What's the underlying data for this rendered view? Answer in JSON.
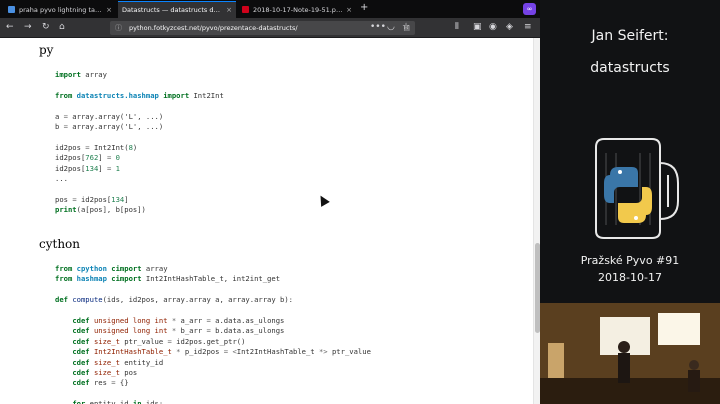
{
  "tabs": [
    {
      "title": "praha pyvo lightning talks (bit…",
      "favicon_color": "#4a90e2",
      "active": false
    },
    {
      "title": "Datastructs — datastructs docume…",
      "favicon_color": "",
      "active": true
    },
    {
      "title": "2018-10-17-Note-19-51.pdf – C…",
      "favicon_color": "#d0021b",
      "favicon_text": "PDF",
      "active": false
    }
  ],
  "navbar": {
    "url": "python.fotkyzcest.net/pyvo/prezentace-datastructs/"
  },
  "sections": [
    {
      "heading": "py",
      "lines": [
        [
          [
            "kw",
            "import"
          ],
          [
            "t",
            " array"
          ]
        ],
        [],
        [
          [
            "kw",
            "from"
          ],
          [
            "t",
            " "
          ],
          [
            "mod",
            "datastructs.hashmap"
          ],
          [
            "t",
            " "
          ],
          [
            "kw",
            "import"
          ],
          [
            "t",
            " Int2Int"
          ]
        ],
        [],
        [
          [
            "t",
            "a "
          ],
          [
            "op",
            "="
          ],
          [
            "t",
            " array.array('L', ...)"
          ]
        ],
        [
          [
            "t",
            "b "
          ],
          [
            "op",
            "="
          ],
          [
            "t",
            " array.array('L', ...)"
          ]
        ],
        [],
        [
          [
            "t",
            "id2pos "
          ],
          [
            "op",
            "="
          ],
          [
            "t",
            " Int2Int("
          ],
          [
            "num",
            "8"
          ],
          [
            "t",
            ")"
          ]
        ],
        [
          [
            "t",
            "id2pos["
          ],
          [
            "num",
            "762"
          ],
          [
            "t",
            "] "
          ],
          [
            "op",
            "="
          ],
          [
            "t",
            " "
          ],
          [
            "num",
            "0"
          ]
        ],
        [
          [
            "t",
            "id2pos["
          ],
          [
            "num",
            "134"
          ],
          [
            "t",
            "] "
          ],
          [
            "op",
            "="
          ],
          [
            "t",
            " "
          ],
          [
            "num",
            "1"
          ]
        ],
        [
          [
            "t",
            "..."
          ]
        ],
        [],
        [
          [
            "t",
            "pos "
          ],
          [
            "op",
            "="
          ],
          [
            "t",
            " id2pos["
          ],
          [
            "num",
            "134"
          ],
          [
            "t",
            "]"
          ]
        ],
        [
          [
            "kw",
            "print"
          ],
          [
            "t",
            "(a[pos], b[pos])"
          ]
        ]
      ]
    },
    {
      "heading": "cython",
      "lines": [
        [
          [
            "kw",
            "from"
          ],
          [
            "t",
            " "
          ],
          [
            "mod",
            "cpython"
          ],
          [
            "t",
            " "
          ],
          [
            "kw",
            "cimport"
          ],
          [
            "t",
            " array"
          ]
        ],
        [
          [
            "kw",
            "from"
          ],
          [
            "t",
            " "
          ],
          [
            "mod",
            "hashmap"
          ],
          [
            "t",
            " "
          ],
          [
            "kw",
            "cimport"
          ],
          [
            "t",
            " Int2IntHashTable_t, int2int_get"
          ]
        ],
        [],
        [
          [
            "kw",
            "def"
          ],
          [
            "t",
            " "
          ],
          [
            "fn",
            "compute"
          ],
          [
            "t",
            "(ids, id2pos, array.array a, array.array b):"
          ]
        ],
        [],
        [
          [
            "t",
            "    "
          ],
          [
            "kw",
            "cdef"
          ],
          [
            "t",
            " "
          ],
          [
            "ty",
            "unsigned"
          ],
          [
            "t",
            " "
          ],
          [
            "ty",
            "long"
          ],
          [
            "t",
            " "
          ],
          [
            "ty",
            "int"
          ],
          [
            "t",
            " "
          ],
          [
            "op",
            "*"
          ],
          [
            "t",
            " a_arr "
          ],
          [
            "op",
            "="
          ],
          [
            "t",
            " a.data.as_ulongs"
          ]
        ],
        [
          [
            "t",
            "    "
          ],
          [
            "kw",
            "cdef"
          ],
          [
            "t",
            " "
          ],
          [
            "ty",
            "unsigned"
          ],
          [
            "t",
            " "
          ],
          [
            "ty",
            "long"
          ],
          [
            "t",
            " "
          ],
          [
            "ty",
            "int"
          ],
          [
            "t",
            " "
          ],
          [
            "op",
            "*"
          ],
          [
            "t",
            " b_arr "
          ],
          [
            "op",
            "="
          ],
          [
            "t",
            " b.data.as_ulongs"
          ]
        ],
        [
          [
            "t",
            "    "
          ],
          [
            "kw",
            "cdef"
          ],
          [
            "t",
            " "
          ],
          [
            "ty",
            "size_t"
          ],
          [
            "t",
            " ptr_value "
          ],
          [
            "op",
            "="
          ],
          [
            "t",
            " id2pos.get_ptr()"
          ]
        ],
        [
          [
            "t",
            "    "
          ],
          [
            "kw",
            "cdef"
          ],
          [
            "t",
            " "
          ],
          [
            "ty",
            "Int2IntHashTable_t"
          ],
          [
            "t",
            " "
          ],
          [
            "op",
            "*"
          ],
          [
            "t",
            " p_id2pos "
          ],
          [
            "op",
            "="
          ],
          [
            "t",
            " "
          ],
          [
            "op",
            "<"
          ],
          [
            "t",
            "Int2IntHashTable_t "
          ],
          [
            "op",
            "*>"
          ],
          [
            "t",
            " ptr_value"
          ]
        ],
        [
          [
            "t",
            "    "
          ],
          [
            "kw",
            "cdef"
          ],
          [
            "t",
            " "
          ],
          [
            "ty",
            "size_t"
          ],
          [
            "t",
            " entity_id"
          ]
        ],
        [
          [
            "t",
            "    "
          ],
          [
            "kw",
            "cdef"
          ],
          [
            "t",
            " "
          ],
          [
            "ty",
            "size_t"
          ],
          [
            "t",
            " pos"
          ]
        ],
        [
          [
            "t",
            "    "
          ],
          [
            "kw",
            "cdef"
          ],
          [
            "t",
            " res "
          ],
          [
            "op",
            "="
          ],
          [
            "t",
            " {}"
          ]
        ],
        [],
        [
          [
            "t",
            "    "
          ],
          [
            "kw",
            "for"
          ],
          [
            "t",
            " entity_id "
          ],
          [
            "kw",
            "in"
          ],
          [
            "t",
            " ids:"
          ]
        ]
      ]
    }
  ],
  "panel": {
    "speaker": "Jan Seifert:",
    "talk": "datastructs",
    "event": "Pražské Pyvo #91",
    "date": "2018-10-17"
  },
  "colors": {
    "accent": "#0a84ff",
    "keyword": "#007020",
    "module": "#0e84b5",
    "number": "#208050",
    "python_blue": "#3a76a8",
    "python_yellow": "#f2c94c"
  }
}
